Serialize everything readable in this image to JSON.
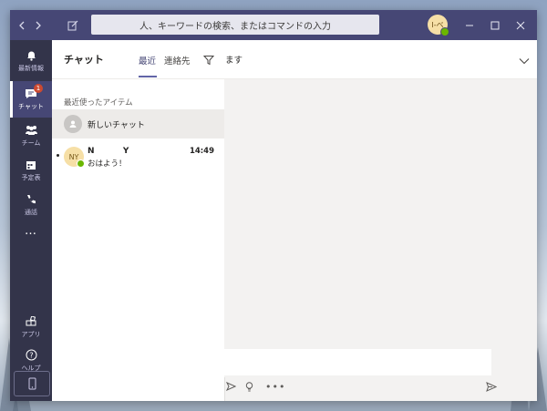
{
  "titlebar": {
    "search_placeholder": "人、キーワードの検索、またはコマンドの入力",
    "user_initials": "I-ベ"
  },
  "rail": {
    "items": [
      {
        "label": "最新情報",
        "icon": "bell-icon"
      },
      {
        "label": "チャット",
        "icon": "chat-icon",
        "badge": "1"
      },
      {
        "label": "チーム",
        "icon": "teams-icon"
      },
      {
        "label": "予定表",
        "icon": "calendar-icon"
      },
      {
        "label": "通話",
        "icon": "phone-icon"
      },
      {
        "label": "…",
        "icon": "more-icon"
      },
      {
        "label": "アプリ",
        "icon": "apps-icon"
      },
      {
        "label": "ヘルプ",
        "icon": "help-icon"
      }
    ]
  },
  "chat_list": {
    "title": "チャット",
    "tabs": [
      "最近",
      "連絡先"
    ],
    "section_label": "最近使ったアイテム",
    "new_chat_label": "新しいチャット",
    "conversations": [
      {
        "initials": "NY",
        "name": "N          Y",
        "time": "14:49",
        "preview": "おはよう！"
      }
    ]
  },
  "conversation": {
    "title": "ます"
  },
  "colors": {
    "titlebar": "#464775",
    "rail": "#33344a",
    "accent": "#6264a7",
    "presence_available": "#6bb700",
    "badge": "#cc4a31"
  }
}
